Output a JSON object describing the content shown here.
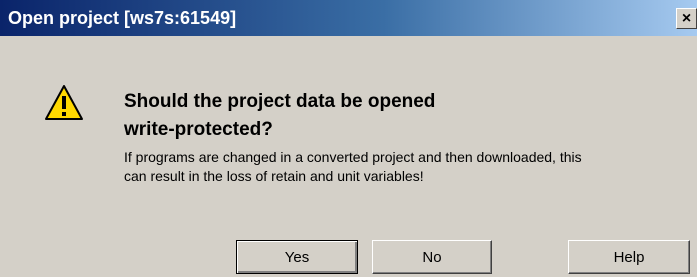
{
  "window": {
    "title": "Open project [ws7s:61549]",
    "close_symbol": "×"
  },
  "message": {
    "icon": "warning-icon",
    "headline_line1": "Should the project data be opened",
    "headline_line2": "write-protected?",
    "detail_line1": "If programs are changed in a converted project and then downloaded, this",
    "detail_line2": "can result in the loss of retain and unit variables!"
  },
  "buttons": {
    "yes": "Yes",
    "no": "No",
    "help": "Help"
  },
  "colors": {
    "dialog_bg": "#d4d0c8",
    "titlebar_start": "#0a246a",
    "titlebar_end": "#a6caf0",
    "warning_yellow": "#ffd800"
  }
}
